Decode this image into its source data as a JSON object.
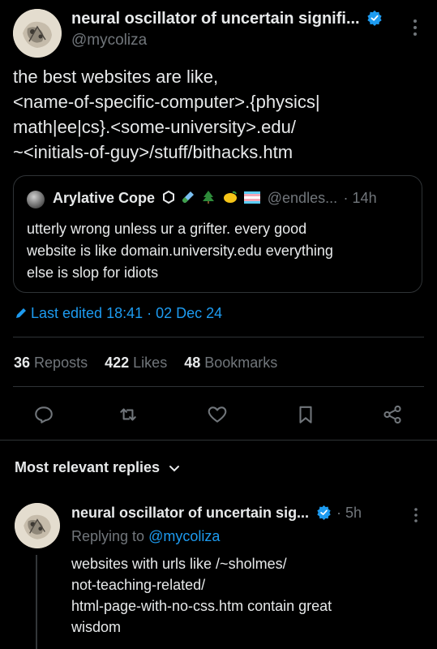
{
  "tweet": {
    "author_name": "neural oscillator of uncertain signifi...",
    "author_handle": "@mycoliza",
    "text_lines": [
      "the best websites are like,",
      "<name-of-specific-computer>.{physics|",
      "math|ee|cs}.<some-university>.edu/",
      "~<initials-of-guy>/stuff/bithacks.htm"
    ],
    "quote": {
      "author_name": "Arylative Cope",
      "author_handle": "@endles...",
      "time": "· 14h",
      "text_lines": [
        "utterly wrong unless ur a grifter. every good",
        "website is like domain.university.edu everything",
        "else is slop for idiots"
      ]
    },
    "edited": "Last edited 18:41 · 02 Dec 24",
    "stats": {
      "reposts_count": "36",
      "reposts_label": "Reposts",
      "likes_count": "422",
      "likes_label": "Likes",
      "bookmarks_count": "48",
      "bookmarks_label": "Bookmarks"
    }
  },
  "replies_section": {
    "label": "Most relevant replies"
  },
  "reply": {
    "author_name": "neural oscillator of uncertain sig...",
    "time": "· 5h",
    "replying_prefix": "Replying to",
    "replying_handle": "@mycoliza",
    "text_lines": [
      "websites with urls like /~sholmes/",
      "not-teaching-related/",
      "html-page-with-no-css.htm contain great",
      "wisdom"
    ]
  },
  "colors": {
    "background": "#000000",
    "text": "#e7e9ea",
    "muted": "#71767b",
    "accent": "#1d9bf0",
    "border": "#2f3336"
  }
}
